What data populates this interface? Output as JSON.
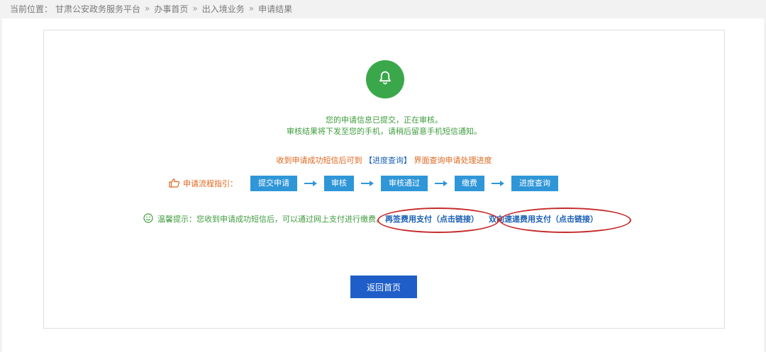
{
  "breadcrumb": {
    "prefix": "当前位置：",
    "items": [
      "甘肃公安政务服务平台",
      "办事首页",
      "出入境业务",
      "申请结果"
    ],
    "separator": "»"
  },
  "result": {
    "icon": "bell-icon",
    "line1": "您的申请信息已提交，正在审核。",
    "line2": "审核结果将下发至您的手机，请稍后留意手机短信通知。"
  },
  "notice": {
    "before": "收到申请成功短信后可到",
    "link": "【进度查询】",
    "after": "界面查询申请处理进度"
  },
  "flow": {
    "label": "申请流程指引：",
    "steps": [
      "提交申请",
      "审核",
      "审核通过",
      "缴费",
      "进度查询"
    ]
  },
  "tip": {
    "text": "温馨提示：您收到申请成功短信后，可以通过网上支付进行缴费。",
    "pay_sign_link": "再签费用支付（点击链接）",
    "pay_express_link": "双向速递费用支付（点击链接）"
  },
  "actions": {
    "home_label": "返回首页"
  },
  "colors": {
    "success_green": "#3aa84a",
    "step_blue": "#2f96d8",
    "button_blue": "#1f5ec8",
    "notice_orange": "#e0661c",
    "annotation_red": "#c62a2a"
  }
}
